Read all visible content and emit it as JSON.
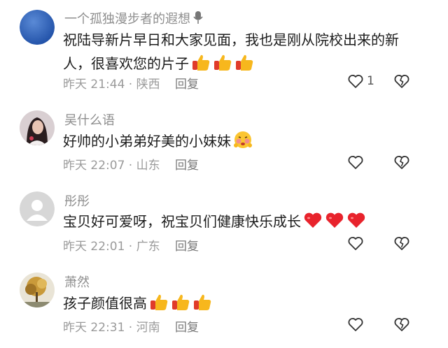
{
  "comments": [
    {
      "username": "一个孤独漫步者的遐想",
      "text": "祝陆导新片早日和大家见面，我也是刚从院校出来的新人，很喜欢您的片子",
      "emojis": [
        "thumbs-up",
        "thumbs-up",
        "thumbs-up"
      ],
      "time": "昨天 21:44",
      "location": "陕西",
      "reply_label": "回复",
      "like_count": "1",
      "avatar": "blue-circle"
    },
    {
      "username": "吴什么语",
      "text": "好帅的小弟弟好美的小妹妹",
      "emojis": [
        "blush-face"
      ],
      "time": "昨天 22:07",
      "location": "山东",
      "reply_label": "回复",
      "like_count": "",
      "avatar": "girl-photo"
    },
    {
      "username": "彤彤",
      "text": "宝贝好可爱呀，祝宝贝们健康快乐成长",
      "emojis": [
        "red-heart",
        "red-heart",
        "red-heart"
      ],
      "time": "昨天 22:01",
      "location": "广东",
      "reply_label": "回复",
      "like_count": "",
      "avatar": "default-grey-person"
    },
    {
      "username": "萧然",
      "text": "孩子颜值很高",
      "emojis": [
        "thumbs-up",
        "thumbs-up",
        "thumbs-up"
      ],
      "time": "昨天 22:31",
      "location": "河南",
      "reply_label": "回复",
      "like_count": "",
      "avatar": "tree-photo"
    }
  ],
  "colors": {
    "text": "#1c1c1c",
    "secondary": "#8e8e8e",
    "avatar_blue": "#2f5fb8"
  }
}
